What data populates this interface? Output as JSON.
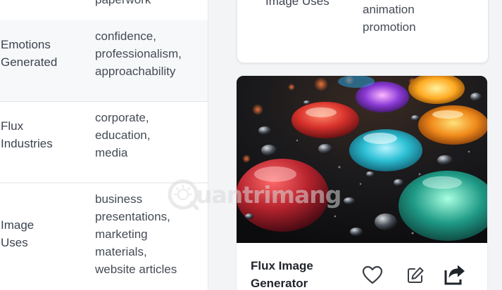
{
  "table": {
    "rows": [
      {
        "key_lines": [],
        "value_lines": [
          "paperwork"
        ]
      },
      {
        "key_lines": [
          "Emotions",
          "Generated"
        ],
        "value_lines": [
          "confidence,",
          "professionalism,",
          "approachability"
        ]
      },
      {
        "key_lines": [
          "Flux",
          "Industries"
        ],
        "value_lines": [
          "corporate,",
          "education,",
          "media"
        ]
      },
      {
        "key_lines": [
          "Image",
          "Uses"
        ],
        "value_lines": [
          "business",
          "presentations,",
          "marketing",
          "materials,",
          "website articles"
        ]
      }
    ]
  },
  "related_card": {
    "key_label": "Image Uses",
    "value_lines": [
      "animation",
      "promotion"
    ]
  },
  "image_card": {
    "title_lines": [
      "Flux Image",
      "Generator"
    ],
    "image_alt_icon": "colorful-droplets-photo",
    "actions": [
      {
        "name": "favorite-button",
        "icon": "heart-icon"
      },
      {
        "name": "edit-button",
        "icon": "edit-icon"
      },
      {
        "name": "share-button",
        "icon": "share-icon"
      }
    ]
  },
  "watermark": {
    "text": "uantrimang"
  },
  "colors": {
    "page_bg": "#f3f4f6",
    "card_bg": "#ffffff",
    "text_primary": "#1f242b",
    "text_secondary": "#454b55",
    "icon": "#3b3f45"
  }
}
